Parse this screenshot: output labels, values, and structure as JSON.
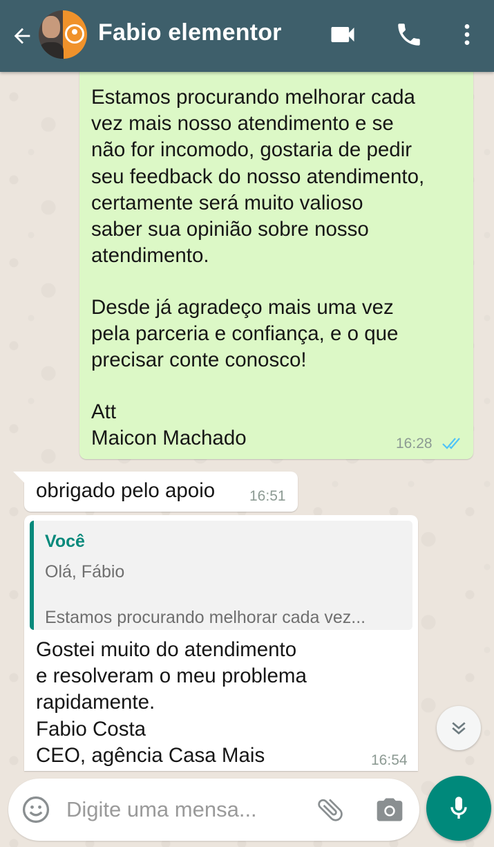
{
  "colors": {
    "header": "#3e5f6b",
    "outgoing_bubble": "#dcf8c6",
    "incoming_bubble": "#ffffff",
    "accent": "#00897b",
    "read_ticks": "#4fc3f7"
  },
  "header": {
    "contact_name": "Fabio elementor",
    "icons": [
      "back-arrow-icon",
      "video-call-icon",
      "phone-icon",
      "more-vert-icon"
    ]
  },
  "messages": [
    {
      "direction": "outgoing",
      "paragraphs": [
        "Estamos procurando melhorar cada\nvez mais nosso atendimento e se\nnão for incomodo, gostaria de pedir\nseu feedback do nosso atendimento,\ncertamente será muito valioso\nsaber sua opinião sobre nosso\natendimento.",
        "Desde já agradeço mais uma vez\npela parceria e confiança, e o que\nprecisar conte conosco!",
        "Att\nMaicon Machado"
      ],
      "time": "16:28",
      "status": "read"
    },
    {
      "direction": "incoming",
      "text": "obrigado pelo apoio",
      "time": "16:51"
    },
    {
      "direction": "incoming",
      "quote": {
        "author": "Você",
        "line1": "Olá, Fábio",
        "line2": "Estamos procurando melhorar cada vez..."
      },
      "text": "Gostei muito do atendimento\ne resolveram o meu problema\nrapidamente.\nFabio Costa\nCEO, agência Casa Mais",
      "time": "16:54"
    }
  ],
  "composer": {
    "placeholder": "Digite uma mensa...",
    "icons": [
      "emoji-icon",
      "attach-icon",
      "camera-icon",
      "mic-icon"
    ]
  },
  "scroll_down_icon": "double-chevron-down-icon"
}
